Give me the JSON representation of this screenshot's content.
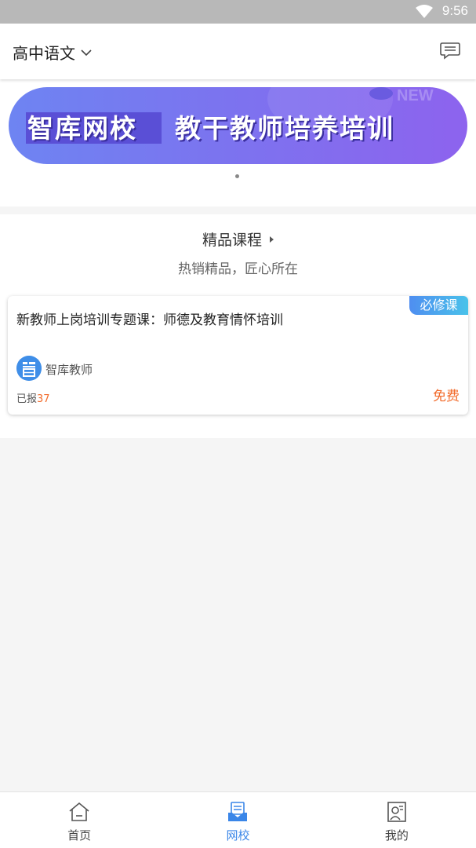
{
  "status_bar": {
    "time": "9:56",
    "wifi_icon": "wifi-icon"
  },
  "header": {
    "subject": "高中语文",
    "dropdown_icon": "chevron-down-icon",
    "message_icon": "message-icon"
  },
  "banner": {
    "title_left": "智库网校",
    "title_right": "教干教师培养培训",
    "watermark": "NEW",
    "page_count": 1,
    "active_index": 0
  },
  "featured": {
    "title": "精品课程",
    "subtitle": "热销精品，匠心所在",
    "courses": [
      {
        "badge": "必修课",
        "title": "新教师上岗培训专题课：师德及教育情怀培训",
        "author": "智库教师",
        "enrolled_label": "已报",
        "enrolled_count": "37",
        "price": "免费"
      }
    ]
  },
  "bottom_nav": [
    {
      "label": "首页",
      "icon": "home-icon",
      "active": false
    },
    {
      "label": "网校",
      "icon": "school-icon",
      "active": true
    },
    {
      "label": "我的",
      "icon": "profile-icon",
      "active": false
    }
  ],
  "colors": {
    "accent": "#3a86e8",
    "price": "#f26b2b",
    "badge": "#4f8ef0"
  }
}
